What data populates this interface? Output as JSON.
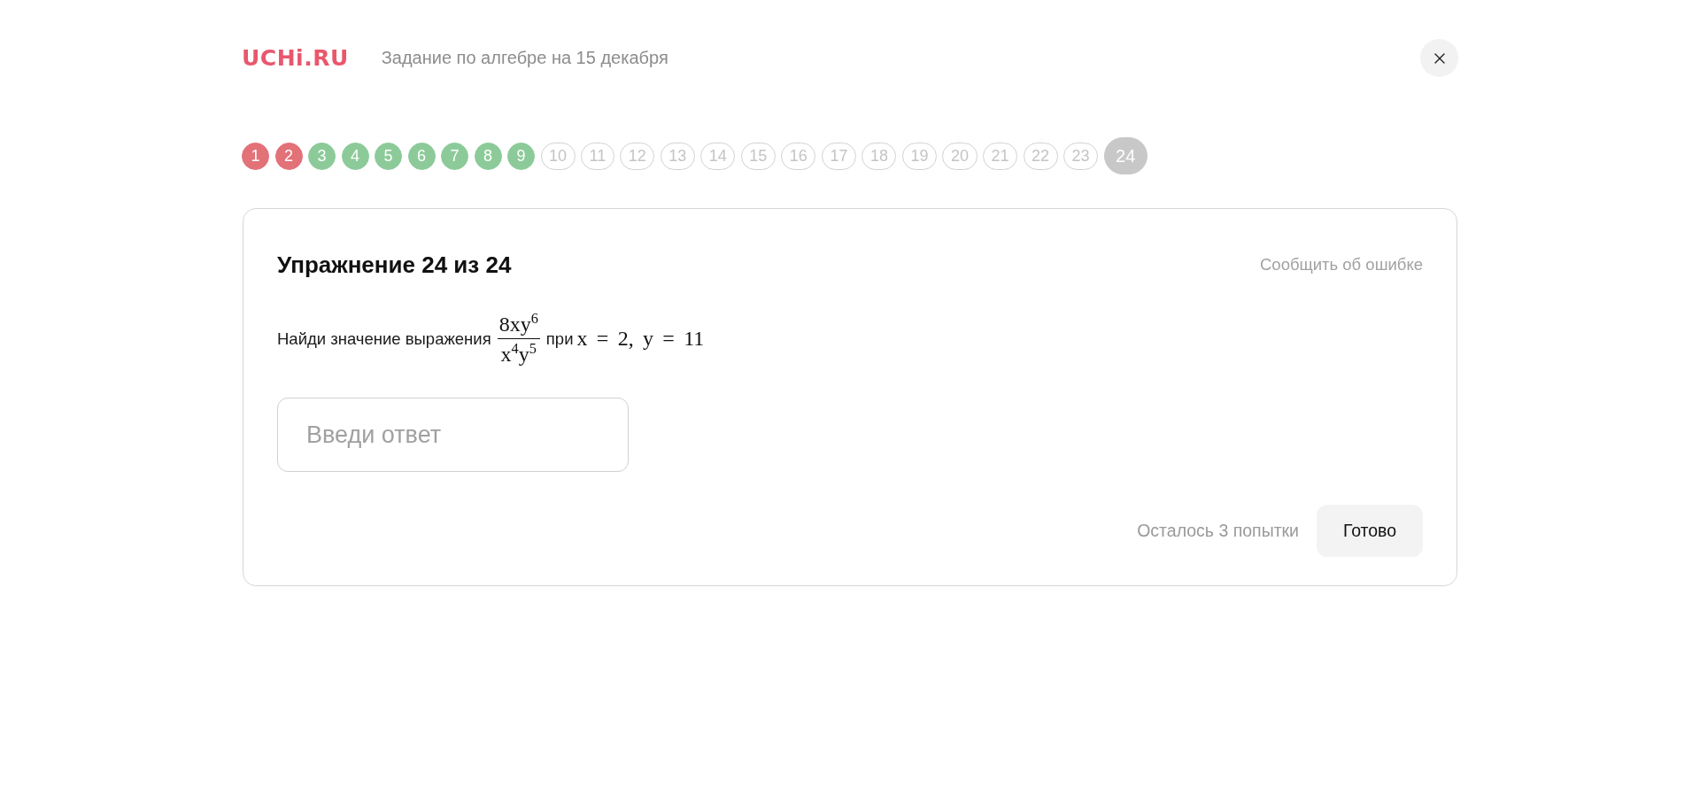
{
  "header": {
    "logo": "UCHi.RU",
    "title": "Задание по алгебре на 15 декабря"
  },
  "progress": [
    {
      "label": "1",
      "kind": "wrong",
      "selected": false
    },
    {
      "label": "2",
      "kind": "wrong",
      "selected": false
    },
    {
      "label": "3",
      "kind": "correct",
      "selected": false
    },
    {
      "label": "4",
      "kind": "correct",
      "selected": false
    },
    {
      "label": "5",
      "kind": "correct",
      "selected": false
    },
    {
      "label": "6",
      "kind": "correct",
      "selected": false
    },
    {
      "label": "7",
      "kind": "correct",
      "selected": false
    },
    {
      "label": "8",
      "kind": "correct",
      "selected": false
    },
    {
      "label": "9",
      "kind": "correct",
      "selected": false
    },
    {
      "label": "10",
      "kind": "open",
      "selected": false
    },
    {
      "label": "11",
      "kind": "open",
      "selected": false
    },
    {
      "label": "12",
      "kind": "open",
      "selected": false
    },
    {
      "label": "13",
      "kind": "open",
      "selected": false
    },
    {
      "label": "14",
      "kind": "open",
      "selected": false
    },
    {
      "label": "15",
      "kind": "open",
      "selected": false
    },
    {
      "label": "16",
      "kind": "open",
      "selected": false
    },
    {
      "label": "17",
      "kind": "open",
      "selected": false
    },
    {
      "label": "18",
      "kind": "open",
      "selected": false
    },
    {
      "label": "19",
      "kind": "open",
      "selected": false
    },
    {
      "label": "20",
      "kind": "open",
      "selected": false
    },
    {
      "label": "21",
      "kind": "open",
      "selected": false
    },
    {
      "label": "22",
      "kind": "open",
      "selected": false
    },
    {
      "label": "23",
      "kind": "open",
      "selected": false
    },
    {
      "label": "24",
      "kind": "open",
      "selected": true
    }
  ],
  "exercise": {
    "title": "Упражнение 24 из 24",
    "report_link": "Сообщить об ошибке",
    "question": {
      "text": "Найди значение выражения",
      "numerator": "8xy$^{6}$",
      "denominator": "x$^{4}$y$^{5}$",
      "joiner": "при",
      "condition": "x = 2, y = 11"
    },
    "answer": {
      "placeholder": "Введи ответ"
    },
    "attempts": "Осталось 3 попытки",
    "submit_button": "Готово"
  }
}
